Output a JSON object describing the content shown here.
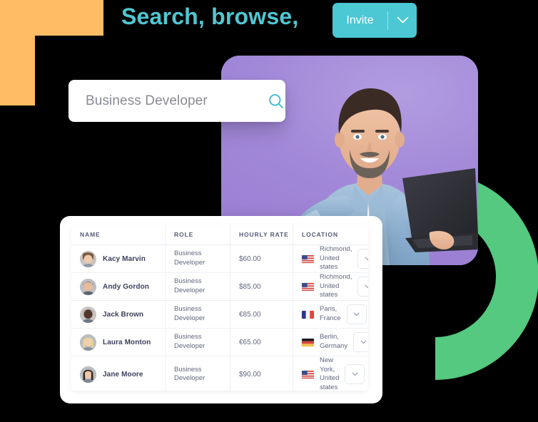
{
  "headline": "Search, browse,",
  "invite": {
    "label": "Invite",
    "caret_icon": "chevron-down-icon"
  },
  "search": {
    "value": "",
    "placeholder": "Business Developer",
    "icon": "search-icon"
  },
  "table": {
    "columns": [
      "NAME",
      "ROLE",
      "HOURLY RATE",
      "LOCATION"
    ],
    "rows": [
      {
        "name": "Kacy Marvin",
        "role": "Business Developer",
        "rate": "$60.00",
        "location": "Richmond, United states",
        "flag": "flag-us",
        "action_icon": "chevron-down-icon"
      },
      {
        "name": "Andy Gordon",
        "role": "Business Developer",
        "rate": "$85.00",
        "location": "Richmond, United states",
        "flag": "flag-us",
        "action_icon": "chevron-down-icon"
      },
      {
        "name": "Jack Brown",
        "role": "Business Developer",
        "rate": "€85.00",
        "location": "Paris, France",
        "flag": "flag-fr",
        "action_icon": "chevron-down-icon"
      },
      {
        "name": "Laura Monton",
        "role": "Business Developer",
        "rate": "€65.00",
        "location": "Berlin, Germany",
        "flag": "flag-de",
        "action_icon": "chevron-down-icon"
      },
      {
        "name": "Jane Moore",
        "role": "Business Developer",
        "rate": "$90.00",
        "location": "New York, United states",
        "flag": "flag-us",
        "action_icon": "chevron-down-icon"
      }
    ]
  },
  "colors": {
    "teal": "#4fc7d2",
    "teal_button": "#4cc7d4",
    "orange": "#ffbc64",
    "green": "#54c97f",
    "purple": "#a389d9",
    "text_dark": "#3c3f5c",
    "text_muted": "#62667f",
    "background": "#000000"
  },
  "photo": {
    "alt": "Smiling bearded man in denim shirt pointing at a laptop he is holding",
    "background_color": "#a389d9"
  }
}
